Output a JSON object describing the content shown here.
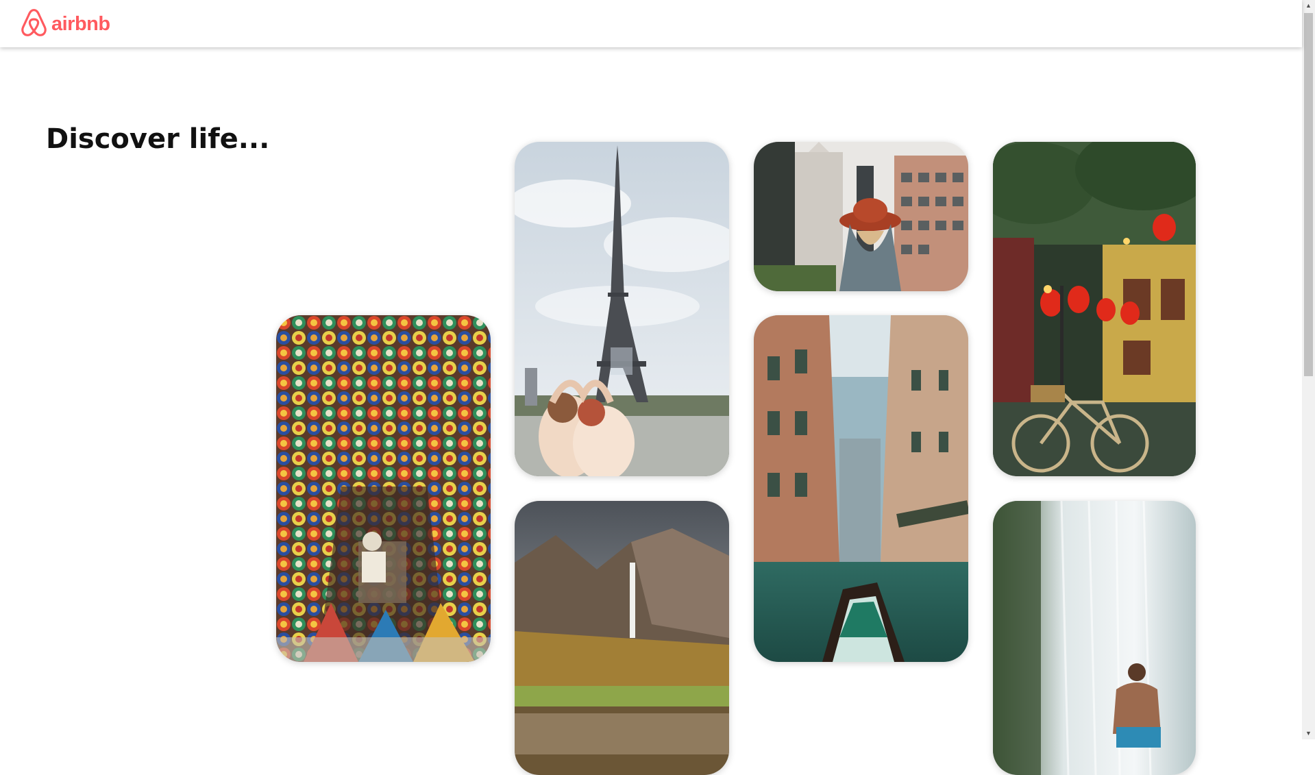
{
  "header": {
    "brand_name": "airbnb",
    "brand_color": "#ff5a5f",
    "logo_icon": "airbnb-belo-icon"
  },
  "hero": {
    "headline": "Discover life..."
  },
  "gallery": [
    {
      "name": "photo-moroccan-pottery-market",
      "subject": "pottery market"
    },
    {
      "name": "photo-eiffel-tower",
      "subject": "eiffel tower"
    },
    {
      "name": "photo-yosemite-falls",
      "subject": "mountain waterfall"
    },
    {
      "name": "photo-city-skyscrapers",
      "subject": "city street"
    },
    {
      "name": "photo-venice-canal",
      "subject": "venice canal"
    },
    {
      "name": "photo-lanterns-bicycle",
      "subject": "lanterns and bicycle"
    },
    {
      "name": "photo-waterfall-person",
      "subject": "waterfall"
    }
  ],
  "scrollbar": {
    "up_icon": "arrow-up-icon",
    "down_icon": "arrow-down-icon"
  }
}
